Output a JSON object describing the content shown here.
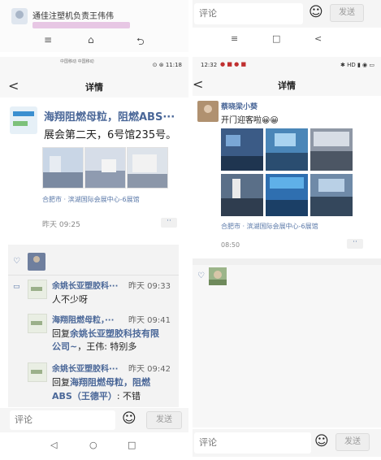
{
  "colors": {
    "link": "#4a6798",
    "location": "#5a78a8",
    "comment_bg": "#f3f3f3"
  },
  "left": {
    "notification": {
      "title": "通佳注塑机负责王伟伟",
      "nav": [
        "menu-icon",
        "home-icon",
        "back-icon"
      ]
    },
    "status_bar": {
      "carrier": "中国移动 中国移动",
      "right": "⊙ ⊛ 11:18"
    },
    "header": {
      "back": "<",
      "title": "详情"
    },
    "post": {
      "author": "海翔阻燃母粒，阻燃ABS···",
      "text": "展会第二天，6号馆235号。",
      "location": "合肥市 · 滨湖国际会展中心-6展馆",
      "time": "昨天 09:25",
      "more": "··"
    },
    "comments": [
      {
        "name": "余姚长亚塑胶科···",
        "time": "昨天 09:33",
        "text": "人不少呀",
        "reply_to": "",
        "reply_text": ""
      },
      {
        "name": "海翔阻燃母粒，···",
        "time": "昨天 09:41",
        "text": "",
        "reply_to": "余姚长亚塑胶科技有限公司~, 王伟",
        "reply_text": ": 特别多",
        "reply_prefix": "回复"
      },
      {
        "name": "余姚长亚塑胶科···",
        "time": "昨天 09:42",
        "text": "",
        "reply_to": "海翔阻燃母粒, 阻燃ABS (王德平)",
        "reply_text": ": 不错",
        "reply_prefix": "回复"
      }
    ],
    "input": {
      "placeholder": "评论",
      "send": "发送"
    },
    "sysnav": [
      "◁",
      "○",
      "□"
    ]
  },
  "right": {
    "input_top": {
      "placeholder": "评论",
      "send": "发送"
    },
    "nav": [
      "≡",
      "□",
      "<"
    ],
    "status_bar": {
      "time": "12:32",
      "right": "✱ HD ▮ ◉ ▭"
    },
    "header": {
      "back": "<",
      "title": "详情"
    },
    "post": {
      "author": "蔡晓梁小葵",
      "text": "开门迎客啦😀😀",
      "location": "合肥市 · 滨湖国际会展中心-6展馆",
      "time": "08:50",
      "more": "··"
    },
    "input": {
      "placeholder": "评论",
      "send": "发送"
    }
  }
}
